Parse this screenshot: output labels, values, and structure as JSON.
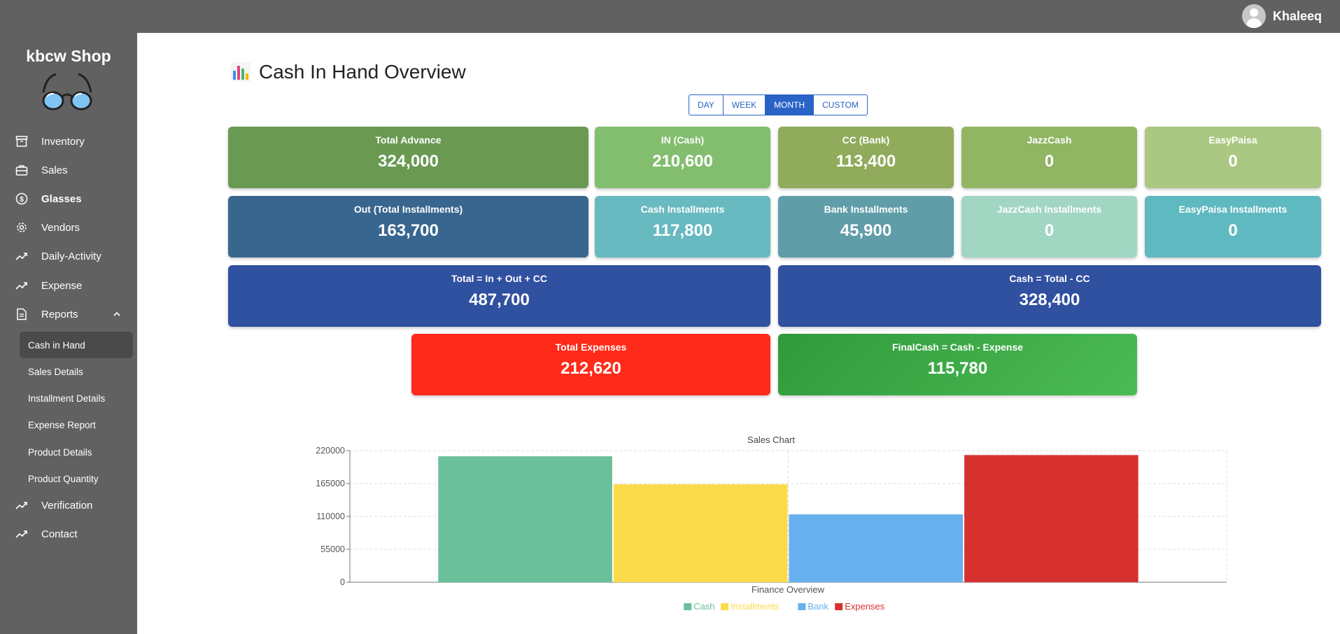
{
  "user": {
    "name": "Khaleeq"
  },
  "sidebar": {
    "brand": "kbcw Shop",
    "items": [
      {
        "label": "Inventory",
        "icon": "archive-icon"
      },
      {
        "label": "Sales",
        "icon": "briefcase-icon"
      },
      {
        "label": "Glasses",
        "icon": "dollar-icon"
      },
      {
        "label": "Vendors",
        "icon": "gear-icon"
      },
      {
        "label": "Daily-Activity",
        "icon": "trending-up-icon"
      },
      {
        "label": "Expense",
        "icon": "trending-up-icon"
      },
      {
        "label": "Reports",
        "icon": "document-icon"
      }
    ],
    "subitems": [
      {
        "label": "Cash in Hand"
      },
      {
        "label": "Sales Details"
      },
      {
        "label": "Installment Details"
      },
      {
        "label": "Expense Report"
      },
      {
        "label": "Product Details"
      },
      {
        "label": "Product Quantity"
      }
    ],
    "bottom_items": [
      {
        "label": "Verification",
        "icon": "trending-up-icon"
      },
      {
        "label": "Contact",
        "icon": "trending-up-icon"
      }
    ]
  },
  "page": {
    "title": "Cash In Hand Overview",
    "title_icon": "bar-chart-icon"
  },
  "periods": [
    "DAY",
    "WEEK",
    "MONTH",
    "CUSTOM"
  ],
  "active_period": "MONTH",
  "cards": {
    "row1": [
      {
        "title": "Total Advance",
        "value": "324,000",
        "color": "#6a9a52"
      },
      {
        "title": "IN (Cash)",
        "value": "210,600",
        "color": "#83bd6e"
      },
      {
        "title": "CC (Bank)",
        "value": "113,400",
        "color": "#8fab5b"
      },
      {
        "title": "JazzCash",
        "value": "0",
        "color": "#91b563"
      },
      {
        "title": "EasyPaisa",
        "value": "0",
        "color": "#abc882"
      }
    ],
    "row2": [
      {
        "title": "Out (Total Installments)",
        "value": "163,700",
        "color": "#39668f"
      },
      {
        "title": "Cash Installments",
        "value": "117,800",
        "color": "#68b9c0"
      },
      {
        "title": "Bank Installments",
        "value": "45,900",
        "color": "#5f9da8"
      },
      {
        "title": "JazzCash Installments",
        "value": "0",
        "color": "#a1d6c3"
      },
      {
        "title": "EasyPaisa Installments",
        "value": "0",
        "color": "#5fb9c0"
      }
    ],
    "row3": [
      {
        "title": "Total = In + Out + CC",
        "value": "487,700",
        "color": "#3050a0"
      },
      {
        "title": "Cash = Total - CC",
        "value": "328,400",
        "color": "#3050a0"
      }
    ],
    "row4": [
      {
        "title": "Total Expenses",
        "value": "212,620",
        "color": "#ff2a1a"
      },
      {
        "title": "FinalCash = Cash - Expense",
        "value": "115,780",
        "color": "#3aa845"
      }
    ]
  },
  "chart_data": {
    "type": "bar",
    "title": "Sales Chart",
    "xlabel": "Finance Overview",
    "ylabel": "",
    "categories": [
      "Finance Overview"
    ],
    "series": [
      {
        "name": "Cash",
        "values": [
          210600
        ],
        "color": "#6ac09a"
      },
      {
        "name": "Installments",
        "values": [
          163700
        ],
        "color": "#fadb4a"
      },
      {
        "name": "Bank",
        "values": [
          113400
        ],
        "color": "#67b0ef"
      },
      {
        "name": "Expenses",
        "values": [
          212620
        ],
        "color": "#d6312f"
      }
    ],
    "ylim": [
      0,
      220000
    ],
    "yticks": [
      "220000",
      "165000",
      "110000",
      "55000",
      "0"
    ],
    "grid": true,
    "legend": "bottom"
  }
}
